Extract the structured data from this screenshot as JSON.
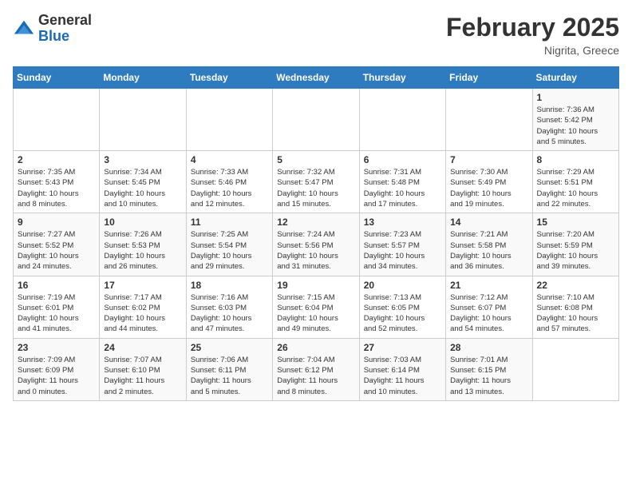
{
  "header": {
    "logo": {
      "general": "General",
      "blue": "Blue"
    },
    "title": "February 2025",
    "location": "Nigrita, Greece"
  },
  "calendar": {
    "days_of_week": [
      "Sunday",
      "Monday",
      "Tuesday",
      "Wednesday",
      "Thursday",
      "Friday",
      "Saturday"
    ],
    "weeks": [
      [
        {
          "day": "",
          "info": ""
        },
        {
          "day": "",
          "info": ""
        },
        {
          "day": "",
          "info": ""
        },
        {
          "day": "",
          "info": ""
        },
        {
          "day": "",
          "info": ""
        },
        {
          "day": "",
          "info": ""
        },
        {
          "day": "1",
          "info": "Sunrise: 7:36 AM\nSunset: 5:42 PM\nDaylight: 10 hours\nand 5 minutes."
        }
      ],
      [
        {
          "day": "2",
          "info": "Sunrise: 7:35 AM\nSunset: 5:43 PM\nDaylight: 10 hours\nand 8 minutes."
        },
        {
          "day": "3",
          "info": "Sunrise: 7:34 AM\nSunset: 5:45 PM\nDaylight: 10 hours\nand 10 minutes."
        },
        {
          "day": "4",
          "info": "Sunrise: 7:33 AM\nSunset: 5:46 PM\nDaylight: 10 hours\nand 12 minutes."
        },
        {
          "day": "5",
          "info": "Sunrise: 7:32 AM\nSunset: 5:47 PM\nDaylight: 10 hours\nand 15 minutes."
        },
        {
          "day": "6",
          "info": "Sunrise: 7:31 AM\nSunset: 5:48 PM\nDaylight: 10 hours\nand 17 minutes."
        },
        {
          "day": "7",
          "info": "Sunrise: 7:30 AM\nSunset: 5:49 PM\nDaylight: 10 hours\nand 19 minutes."
        },
        {
          "day": "8",
          "info": "Sunrise: 7:29 AM\nSunset: 5:51 PM\nDaylight: 10 hours\nand 22 minutes."
        }
      ],
      [
        {
          "day": "9",
          "info": "Sunrise: 7:27 AM\nSunset: 5:52 PM\nDaylight: 10 hours\nand 24 minutes."
        },
        {
          "day": "10",
          "info": "Sunrise: 7:26 AM\nSunset: 5:53 PM\nDaylight: 10 hours\nand 26 minutes."
        },
        {
          "day": "11",
          "info": "Sunrise: 7:25 AM\nSunset: 5:54 PM\nDaylight: 10 hours\nand 29 minutes."
        },
        {
          "day": "12",
          "info": "Sunrise: 7:24 AM\nSunset: 5:56 PM\nDaylight: 10 hours\nand 31 minutes."
        },
        {
          "day": "13",
          "info": "Sunrise: 7:23 AM\nSunset: 5:57 PM\nDaylight: 10 hours\nand 34 minutes."
        },
        {
          "day": "14",
          "info": "Sunrise: 7:21 AM\nSunset: 5:58 PM\nDaylight: 10 hours\nand 36 minutes."
        },
        {
          "day": "15",
          "info": "Sunrise: 7:20 AM\nSunset: 5:59 PM\nDaylight: 10 hours\nand 39 minutes."
        }
      ],
      [
        {
          "day": "16",
          "info": "Sunrise: 7:19 AM\nSunset: 6:01 PM\nDaylight: 10 hours\nand 41 minutes."
        },
        {
          "day": "17",
          "info": "Sunrise: 7:17 AM\nSunset: 6:02 PM\nDaylight: 10 hours\nand 44 minutes."
        },
        {
          "day": "18",
          "info": "Sunrise: 7:16 AM\nSunset: 6:03 PM\nDaylight: 10 hours\nand 47 minutes."
        },
        {
          "day": "19",
          "info": "Sunrise: 7:15 AM\nSunset: 6:04 PM\nDaylight: 10 hours\nand 49 minutes."
        },
        {
          "day": "20",
          "info": "Sunrise: 7:13 AM\nSunset: 6:05 PM\nDaylight: 10 hours\nand 52 minutes."
        },
        {
          "day": "21",
          "info": "Sunrise: 7:12 AM\nSunset: 6:07 PM\nDaylight: 10 hours\nand 54 minutes."
        },
        {
          "day": "22",
          "info": "Sunrise: 7:10 AM\nSunset: 6:08 PM\nDaylight: 10 hours\nand 57 minutes."
        }
      ],
      [
        {
          "day": "23",
          "info": "Sunrise: 7:09 AM\nSunset: 6:09 PM\nDaylight: 11 hours\nand 0 minutes."
        },
        {
          "day": "24",
          "info": "Sunrise: 7:07 AM\nSunset: 6:10 PM\nDaylight: 11 hours\nand 2 minutes."
        },
        {
          "day": "25",
          "info": "Sunrise: 7:06 AM\nSunset: 6:11 PM\nDaylight: 11 hours\nand 5 minutes."
        },
        {
          "day": "26",
          "info": "Sunrise: 7:04 AM\nSunset: 6:12 PM\nDaylight: 11 hours\nand 8 minutes."
        },
        {
          "day": "27",
          "info": "Sunrise: 7:03 AM\nSunset: 6:14 PM\nDaylight: 11 hours\nand 10 minutes."
        },
        {
          "day": "28",
          "info": "Sunrise: 7:01 AM\nSunset: 6:15 PM\nDaylight: 11 hours\nand 13 minutes."
        },
        {
          "day": "",
          "info": ""
        }
      ]
    ]
  }
}
